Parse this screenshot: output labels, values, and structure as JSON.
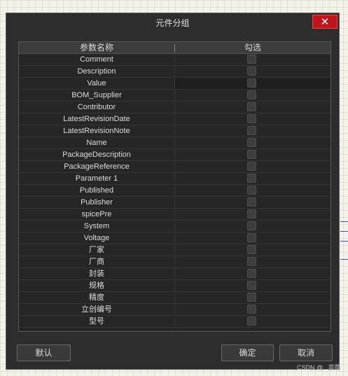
{
  "dialog": {
    "title": "元件分组",
    "close_label": "✕"
  },
  "table": {
    "headers": [
      "参数名称",
      "勾选"
    ],
    "rows": [
      {
        "name": "Comment",
        "checked": false
      },
      {
        "name": "Description",
        "checked": false
      },
      {
        "name": "Value",
        "checked": false,
        "selected": true
      },
      {
        "name": "BOM_Supplier",
        "checked": false
      },
      {
        "name": "Contributor",
        "checked": false
      },
      {
        "name": "LatestRevisionDate",
        "checked": false
      },
      {
        "name": "LatestRevisionNote",
        "checked": false
      },
      {
        "name": "Name",
        "checked": false
      },
      {
        "name": "PackageDescription",
        "checked": false
      },
      {
        "name": "PackageReference",
        "checked": false
      },
      {
        "name": "Parameter 1",
        "checked": false
      },
      {
        "name": "Published",
        "checked": false
      },
      {
        "name": "Publisher",
        "checked": false
      },
      {
        "name": "spicePre",
        "checked": false
      },
      {
        "name": "System",
        "checked": false
      },
      {
        "name": "Voltage",
        "checked": false
      },
      {
        "name": "厂家",
        "checked": false
      },
      {
        "name": "厂商",
        "checked": false
      },
      {
        "name": "封装",
        "checked": false
      },
      {
        "name": "规格",
        "checked": false
      },
      {
        "name": "精度",
        "checked": false
      },
      {
        "name": "立创编号",
        "checked": false
      },
      {
        "name": "型号",
        "checked": false
      }
    ]
  },
  "buttons": {
    "default_label": "默认",
    "ok_label": "确定",
    "cancel_label": "取消"
  },
  "watermark": "CSDN @...芸荫",
  "colors": {
    "dialog_bg": "#2d2d2d",
    "close_button": "#c0151d",
    "text": "#dcdcdc"
  }
}
